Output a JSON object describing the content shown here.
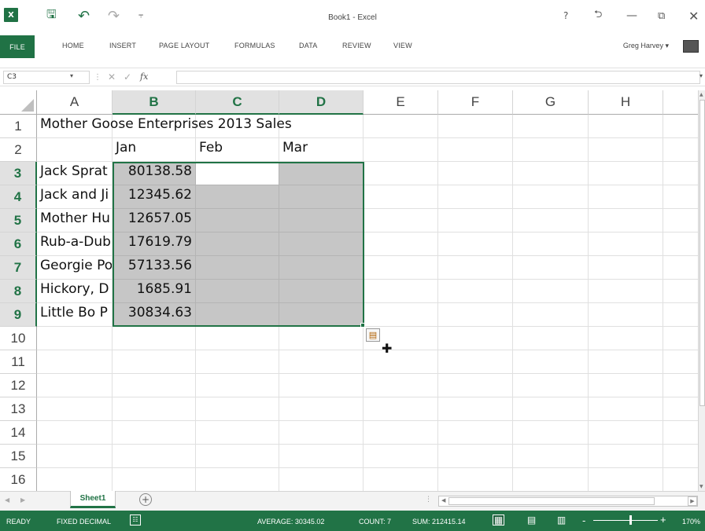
{
  "window": {
    "title": "Book1 - Excel",
    "app_icon": "excel-icon",
    "quick_access": [
      "save-icon",
      "undo-icon",
      "redo-icon",
      "customize-qat-icon"
    ],
    "controls": [
      "help",
      "ribbon-display-options",
      "minimize",
      "restore",
      "close"
    ],
    "help_label": "?"
  },
  "menu": {
    "tabs": [
      "FILE",
      "HOME",
      "INSERT",
      "PAGE LAYOUT",
      "FORMULAS",
      "DATA",
      "REVIEW",
      "VIEW"
    ],
    "user": "Greg Harvey",
    "user_dropdown": "▾"
  },
  "formula_bar": {
    "name_box": "C3",
    "fx": "fx",
    "formula": ""
  },
  "columns": [
    "A",
    "B",
    "C",
    "D",
    "E",
    "F",
    "G",
    "H"
  ],
  "selected_columns": [
    "B",
    "C",
    "D"
  ],
  "rows": [
    "1",
    "2",
    "3",
    "4",
    "5",
    "6",
    "7",
    "8",
    "9",
    "10",
    "11",
    "12",
    "13",
    "14",
    "15",
    "16"
  ],
  "selected_rows": [
    "3",
    "4",
    "5",
    "6",
    "7",
    "8",
    "9"
  ],
  "cells": {
    "A1": "Mother Goose Enterprises 2013 Sales",
    "B2": "Jan",
    "C2": "Feb",
    "D2": "Mar",
    "A3": "Jack Sprat",
    "A4": "Jack and Ji",
    "A5": "Mother Hu",
    "A6": "Rub-a-Dub",
    "A7": "Georgie Po",
    "A8": "Hickory, D",
    "A9": "Little Bo P",
    "B3": "80138.58",
    "B4": "12345.62",
    "B5": "12657.05",
    "B6": "17619.79",
    "B7": "57133.56",
    "B8": "1685.91",
    "B9": "30834.63"
  },
  "selection": {
    "range": "B3:D9",
    "active_cell": "C3"
  },
  "sheets": {
    "tabs": [
      "Sheet1"
    ],
    "active": "Sheet1",
    "add_label": "+"
  },
  "status_bar": {
    "mode": "READY",
    "fixed_decimal": "FIXED DECIMAL",
    "average": "AVERAGE: 30345.02",
    "count": "COUNT: 7",
    "sum": "SUM: 212415.14",
    "zoom": "170%",
    "zoom_minus": "-",
    "zoom_plus": "+"
  },
  "colors": {
    "excel_green": "#217346",
    "selection_fill": "#c6c6c6",
    "header_selected": "#e1e1e1"
  }
}
